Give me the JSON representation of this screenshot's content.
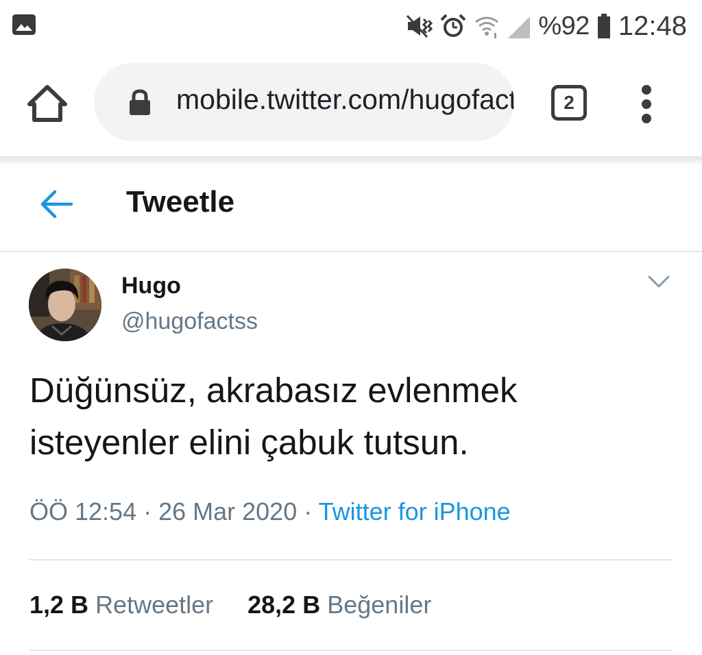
{
  "status_bar": {
    "battery": "%92",
    "time": "12:48",
    "icons": [
      "gallery-icon",
      "mute-vibrate-icon",
      "alarm-icon",
      "wifi-icon",
      "signal-icon",
      "battery-icon"
    ]
  },
  "browser": {
    "url": "mobile.twitter.com/hugofactss/status",
    "tab_count": "2"
  },
  "header": {
    "title": "Tweetle"
  },
  "tweet": {
    "author_name": "Hugo",
    "author_handle": "@hugofactss",
    "text_line1": "Düğünsüz, akrabasız evlenmek",
    "text_line2": "isteyenler elini çabuk tutsun.",
    "timestamp": "ÖÖ 12:54 · 26 Mar 2020",
    "separator": " · ",
    "source": "Twitter for iPhone",
    "retweet_count": "1,2 B",
    "retweet_label": "Retweetler",
    "like_count": "28,2 B",
    "like_label": "Beğeniler"
  },
  "colors": {
    "accent": "#1b95e0",
    "secondary_text": "#657786",
    "primary_text": "#14171a",
    "divider": "#e1e8ed",
    "url_pill": "#f1f3f4"
  }
}
